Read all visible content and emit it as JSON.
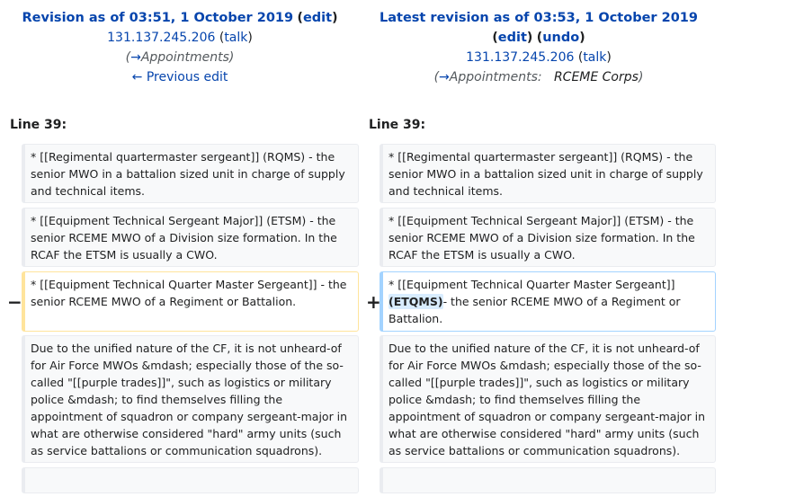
{
  "left_header": {
    "title_prefix": "Revision as of 03:51, 1 October 2019",
    "edit_label": "edit",
    "user": "131.137.245.206",
    "talk_label": "talk",
    "summary_arrow": "→",
    "summary_section": "Appointments",
    "prev_edit": "← Previous edit"
  },
  "right_header": {
    "title": "Latest revision as of 03:53, 1 October 2019",
    "edit_label": "edit",
    "undo_label": "undo",
    "user": "131.137.245.206",
    "talk_label": "talk",
    "summary_arrow": "→",
    "summary_section": "Appointments:",
    "summary_text": "RCEME Corps"
  },
  "line_label_left": "Line 39:",
  "line_label_right": "Line 39:",
  "markers": {
    "minus": "−",
    "plus": "+"
  },
  "rows": {
    "r1_left": "* [[Regimental quartermaster sergeant]] (RQMS) - the senior MWO in a battalion sized unit in charge of supply and technical items.",
    "r1_right": "* [[Regimental quartermaster sergeant]] (RQMS) - the senior MWO in a battalion sized unit in charge of supply and technical items.",
    "r2_left": "* [[Equipment Technical Sergeant Major]] (ETSM) - the senior RCEME MWO of a Division size formation. In the RCAF the ETSM is usually a CWO.",
    "r2_right": "* [[Equipment Technical Sergeant Major]] (ETSM) - the senior RCEME MWO of a Division size formation. In the RCAF the ETSM is usually a CWO.",
    "r3_left": "* [[Equipment Technical Quarter Master Sergeant]] - the senior RCEME MWO of a Regiment or Battalion.",
    "r3_right_pre": "* [[Equipment Technical Quarter Master Sergeant]] ",
    "r3_right_ins": "(ETQMS)",
    "r3_right_post": "- the senior RCEME MWO of a Regiment or Battalion.",
    "r4_left": "Due to the unified nature of the CF, it is not unheard-of for Air Force MWOs &mdash; especially those of the so-called \"[[purple trades]]\", such as logistics or military police &mdash; to find themselves filling the appointment of squadron or company sergeant-major in what are otherwise considered \"hard\" army units (such as service battalions or communication squadrons).",
    "r4_right": "Due to the unified nature of the CF, it is not unheard-of for Air Force MWOs &mdash; especially those of the so-called \"[[purple trades]]\", such as logistics or military police &mdash; to find themselves filling the appointment of squadron or company sergeant-major in what are otherwise considered \"hard\" army units (such as service battalions or communication squadrons)."
  }
}
